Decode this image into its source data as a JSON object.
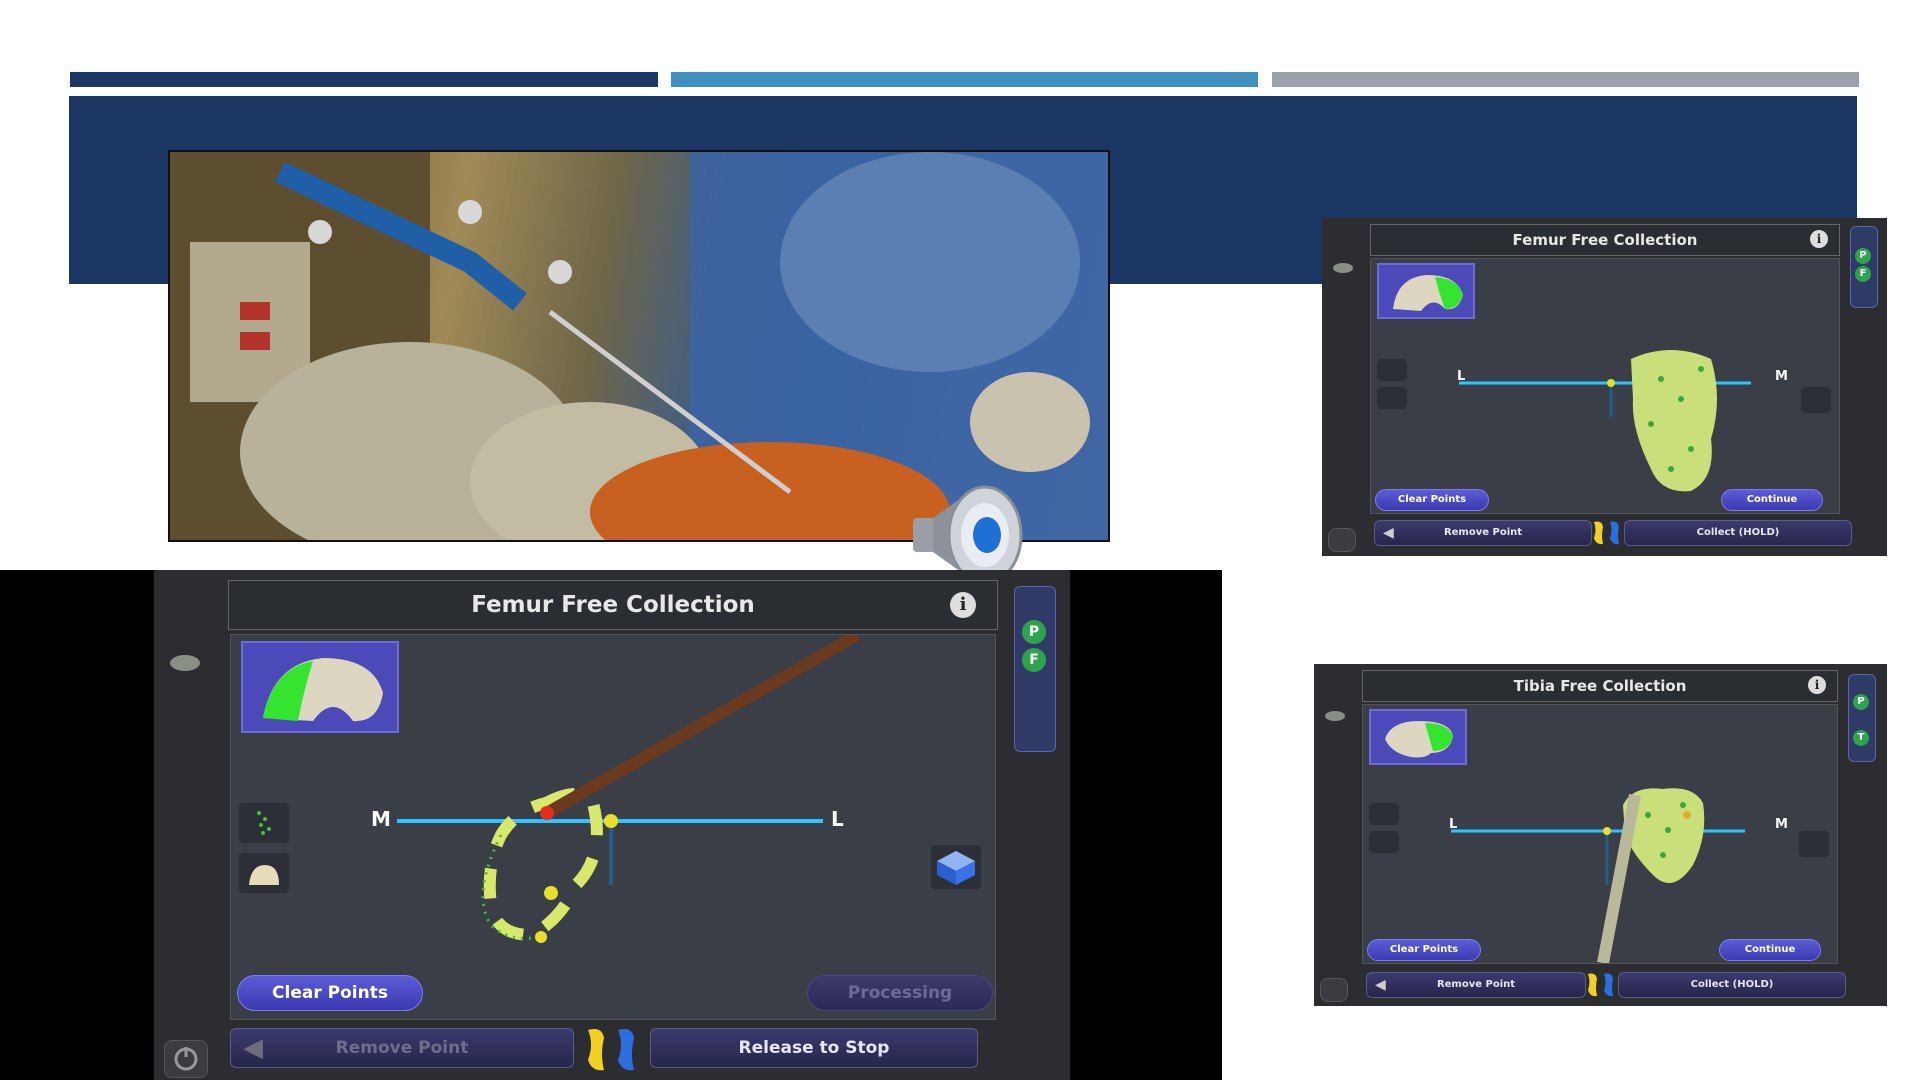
{
  "slide": {
    "bar_colors": [
      "#1c3663",
      "#3f8fbf",
      "#9aa1ab"
    ],
    "title_band_color": "#1c3663"
  },
  "main_panel": {
    "title": "Femur Free Collection",
    "axis_left": "M",
    "axis_right": "L",
    "clear_points": "Clear Points",
    "processing": "Processing",
    "remove_point": "Remove Point",
    "release_to_stop": "Release to Stop",
    "badges": [
      "P",
      "F"
    ],
    "info": "i"
  },
  "top_right_panel": {
    "title": "Femur Free Collection",
    "axis_left": "L",
    "axis_right": "M",
    "clear_points": "Clear Points",
    "continue": "Continue",
    "remove_point": "Remove Point",
    "collect": "Collect (HOLD)",
    "badges": [
      "P",
      "F"
    ],
    "info": "i"
  },
  "bottom_right_panel": {
    "title": "Tibia Free Collection",
    "axis_left": "L",
    "axis_right": "M",
    "clear_points": "Clear Points",
    "continue": "Continue",
    "remove_point": "Remove Point",
    "collect": "Collect (HOLD)",
    "badges": [
      "P",
      "T"
    ],
    "info": "i"
  },
  "icons": {
    "speaker": "speaker-icon",
    "power": "power-icon",
    "foot_markers": "foot-marker-icon",
    "back_arrow": "back-arrow-icon"
  }
}
